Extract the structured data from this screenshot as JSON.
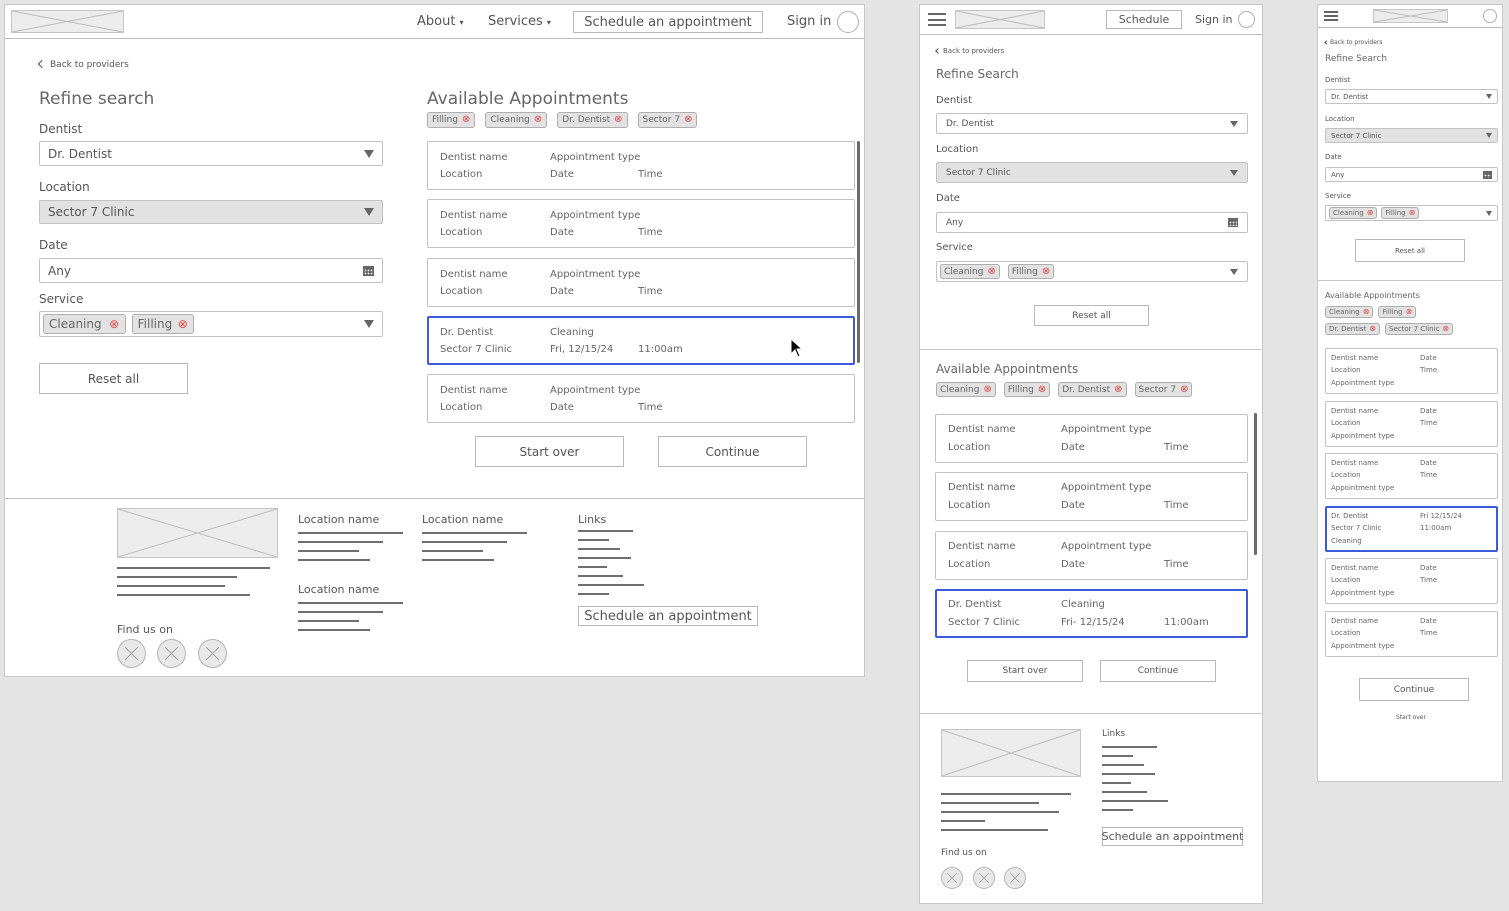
{
  "desktop": {
    "nav": {
      "about_label": "About",
      "services_label": "Services",
      "schedule_label": "Schedule an appointment",
      "signin_label": "Sign in",
      "caret": "▾"
    },
    "back_link": "Back to providers",
    "refine": {
      "title": "Refine search",
      "dentist_label": "Dentist",
      "dentist_value": "Dr. Dentist",
      "location_label": "Location",
      "location_value": "Sector 7 Clinic",
      "date_label": "Date",
      "date_value": "Any",
      "service_label": "Service",
      "service_chips": [
        "Cleaning",
        "Filling"
      ],
      "reset_label": "Reset all"
    },
    "appointments": {
      "title": "Available Appointments",
      "filter_chips": [
        "Filling",
        "Cleaning",
        "Dr. Dentist",
        "Sector 7"
      ],
      "cards": [
        {
          "dentist": "Dentist name",
          "type": "Appointment type",
          "location": "Location",
          "date": "Date",
          "time": "Time",
          "selected": false
        },
        {
          "dentist": "Dentist name",
          "type": "Appointment type",
          "location": "Location",
          "date": "Date",
          "time": "Time",
          "selected": false
        },
        {
          "dentist": "Dentist name",
          "type": "Appointment type",
          "location": "Location",
          "date": "Date",
          "time": "Time",
          "selected": false
        },
        {
          "dentist": "Dr. Dentist",
          "type": "Cleaning",
          "location": "Sector 7 Clinic",
          "date": "Fri, 12/15/24",
          "time": "11:00am",
          "selected": true
        },
        {
          "dentist": "Dentist name",
          "type": "Appointment type",
          "location": "Location",
          "date": "Date",
          "time": "Time",
          "selected": false
        }
      ],
      "start_over_label": "Start over",
      "continue_label": "Continue"
    },
    "footer": {
      "location_headings": [
        "Location name",
        "Location name",
        "Location name"
      ],
      "links_heading": "Links",
      "find_us_label": "Find us on",
      "schedule_label": "Schedule an appointment"
    }
  },
  "tablet": {
    "nav": {
      "schedule_label": "Schedule",
      "signin_label": "Sign in"
    },
    "back_link": "Back to providers",
    "refine": {
      "title": "Refine Search",
      "dentist_label": "Dentist",
      "dentist_value": "Dr. Dentist",
      "location_label": "Location",
      "location_value": "Sector 7 Clinic",
      "date_label": "Date",
      "date_value": "Any",
      "service_label": "Service",
      "service_chips": [
        "Cleaning",
        "Filling"
      ],
      "reset_label": "Reset all"
    },
    "appointments": {
      "title": "Available Appointments",
      "filter_chips": [
        "Cleaning",
        "Filling",
        "Dr. Dentist",
        "Sector 7"
      ],
      "cards": [
        {
          "dentist": "Dentist name",
          "type": "Appointment type",
          "location": "Location",
          "date": "Date",
          "time": "Time",
          "selected": false
        },
        {
          "dentist": "Dentist name",
          "type": "Appointment type",
          "location": "Location",
          "date": "Date",
          "time": "Time",
          "selected": false
        },
        {
          "dentist": "Dentist name",
          "type": "Appointment type",
          "location": "Location",
          "date": "Date",
          "time": "Time",
          "selected": false
        },
        {
          "dentist": "Dr. Dentist",
          "type": "Cleaning",
          "location": "Sector 7 Clinic",
          "date": "Fri- 12/15/24",
          "time": "11:00am",
          "selected": true
        }
      ],
      "start_over_label": "Start over",
      "continue_label": "Continue"
    },
    "footer": {
      "links_heading": "Links",
      "find_us_label": "Find us on",
      "schedule_label": "Schedule an appointment"
    }
  },
  "mobile": {
    "back_link": "Back to providers",
    "refine": {
      "title": "Refine Search",
      "dentist_label": "Dentist",
      "dentist_value": "Dr. Dentist",
      "location_label": "Location",
      "location_value": "Sector 7 Clinic",
      "date_label": "Date",
      "date_value": "Any",
      "service_label": "Service",
      "service_chips": [
        "Cleaning",
        "Filling"
      ],
      "reset_label": "Reset all"
    },
    "appointments": {
      "title": "Available Appointments",
      "filter_chips": [
        "Cleaning",
        "Filling",
        "Dr. Dentist",
        "Sector 7 Clinic"
      ],
      "cards": [
        {
          "dentist": "Dentist name",
          "location": "Location",
          "type": "Appointment type",
          "date": "Date",
          "time": "Time",
          "selected": false
        },
        {
          "dentist": "Dentist name",
          "location": "Location",
          "type": "Appointment type",
          "date": "Date",
          "time": "Time",
          "selected": false
        },
        {
          "dentist": "Dentist name",
          "location": "Location",
          "type": "Appointment type",
          "date": "Date",
          "time": "Time",
          "selected": false
        },
        {
          "dentist": "Dr. Dentist",
          "location": "Sector 7 Clinic",
          "type": "Cleaning",
          "date": "Fri 12/15/24",
          "time": "11:00am",
          "selected": true
        },
        {
          "dentist": "Dentist name",
          "location": "Location",
          "type": "Appointment type",
          "date": "Date",
          "time": "Time",
          "selected": false
        },
        {
          "dentist": "Dentist name",
          "location": "Location",
          "type": "Appointment type",
          "date": "Date",
          "time": "Time",
          "selected": false
        }
      ],
      "continue_label": "Continue",
      "start_over_label": "Start over"
    }
  },
  "icons": {
    "chip_remove": "⊗",
    "back_chevron": "chevron-left"
  },
  "colors": {
    "selected_border": "#3d5bd9",
    "chip_remove": "#e0494b",
    "background": "#e4e4e4"
  }
}
